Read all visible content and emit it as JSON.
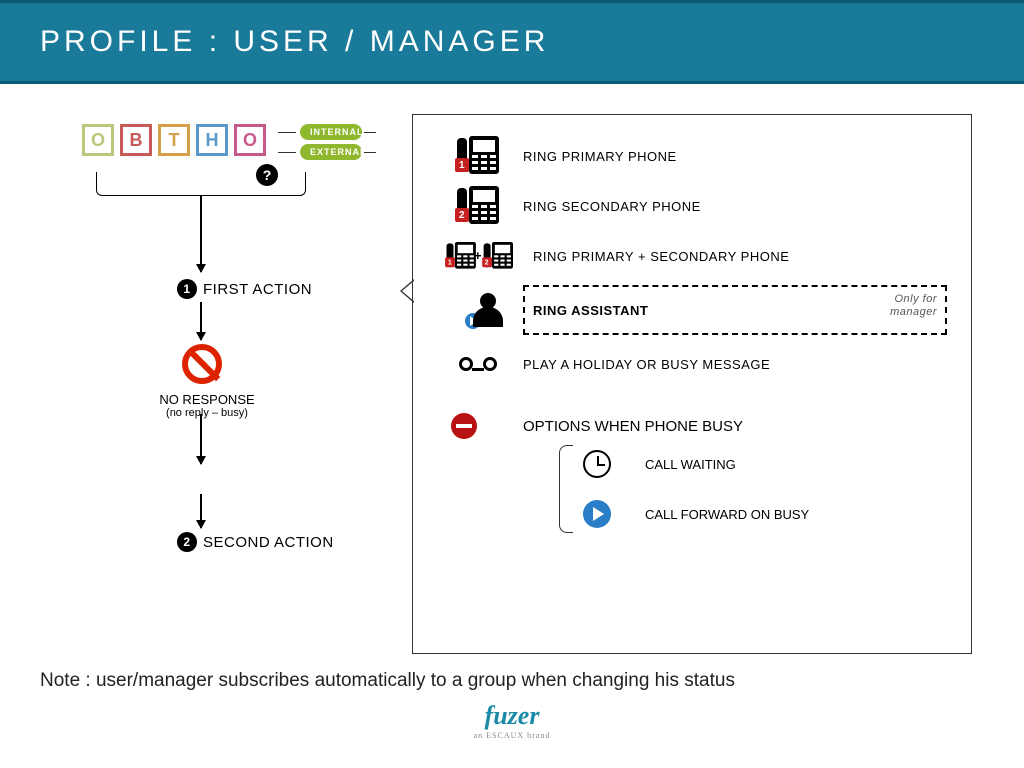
{
  "header": {
    "title": "Profile : user / manager"
  },
  "tiles": {
    "o1": "O",
    "b": "B",
    "t": "T",
    "h": "H",
    "o2": "O"
  },
  "pills": {
    "internal": "INTERNAL",
    "external": "EXTERNAL"
  },
  "qmark": "?",
  "flow": {
    "step1_num": "1",
    "step1_label": "FIRST ACTION",
    "no_response": "NO RESPONSE",
    "no_response_sub": "(no reply – busy)",
    "step2_num": "2",
    "step2_label": "SECOND ACTION"
  },
  "actions": {
    "ring_primary": "RING PRIMARY PHONE",
    "ring_secondary": "RING SECONDARY PHONE",
    "ring_both": "RING PRIMARY + SECONDARY PHONE",
    "ring_assistant": "RING ASSISTANT",
    "assistant_note_l1": "Only for",
    "assistant_note_l2": "manager",
    "play_message": "PLAY A HOLIDAY OR BUSY MESSAGE",
    "options_busy": "OPTIONS WHEN PHONE BUSY",
    "call_waiting": "CALL WAITING",
    "call_forward": "CALL FORWARD ON BUSY",
    "badge1": "1",
    "badge2": "2",
    "plus": "+"
  },
  "footer": {
    "note": "Note : user/manager subscribes automatically to a group when changing his status",
    "logo": "fuzer",
    "logo_sub": "an ESCAUX brand"
  }
}
